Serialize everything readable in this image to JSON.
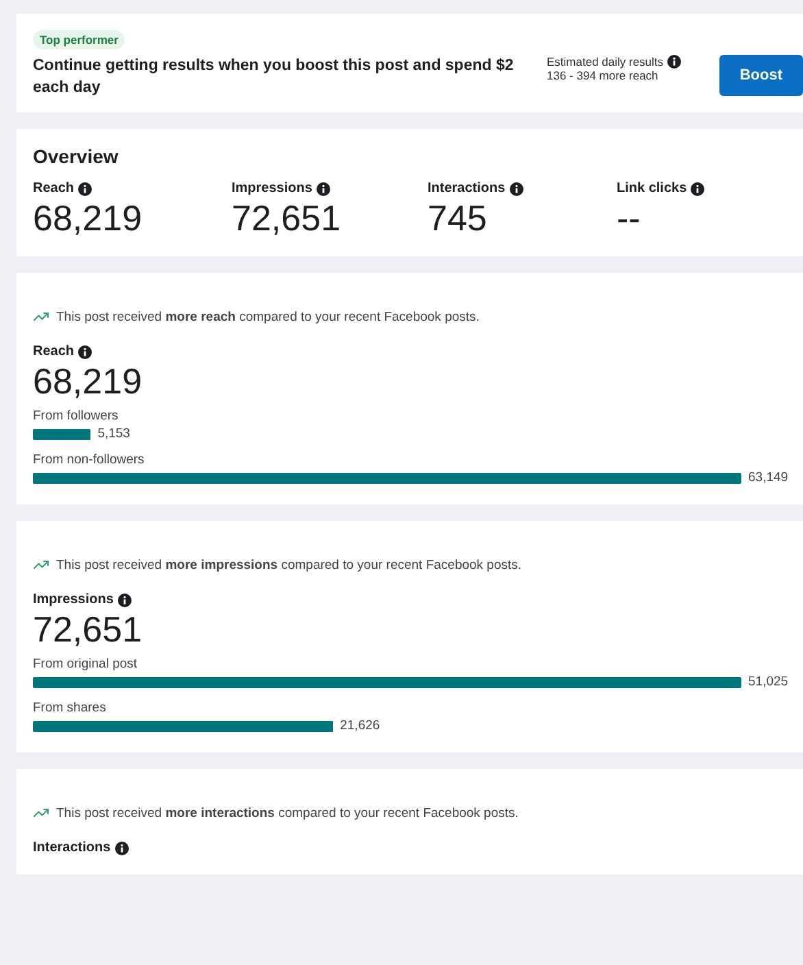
{
  "boost_card": {
    "badge": "Top performer",
    "message": "Continue getting results when you boost this post and spend $2 each day",
    "estimate_label": "Estimated daily results",
    "estimate_value": "136 - 394 more reach",
    "button": "Boost"
  },
  "overview": {
    "title": "Overview",
    "metrics": [
      {
        "label": "Reach",
        "value": "68,219"
      },
      {
        "label": "Impressions",
        "value": "72,651"
      },
      {
        "label": "Interactions",
        "value": "745"
      },
      {
        "label": "Link clicks",
        "value": "--"
      }
    ]
  },
  "sections": [
    {
      "insight": "This post received **more reach** compared to your recent Facebook posts.",
      "label": "Reach",
      "value": "68,219",
      "chart_data": {
        "type": "bar",
        "orientation": "horizontal",
        "categories": [
          "From followers",
          "From non-followers"
        ],
        "values": [
          5153,
          63149
        ],
        "value_labels": [
          "5,153",
          "63,149"
        ]
      }
    },
    {
      "insight": "This post received **more impressions** compared to your recent Facebook posts.",
      "label": "Impressions",
      "value": "72,651",
      "chart_data": {
        "type": "bar",
        "orientation": "horizontal",
        "categories": [
          "From original post",
          "From shares"
        ],
        "values": [
          51025,
          21626
        ],
        "value_labels": [
          "51,025",
          "21,626"
        ]
      }
    },
    {
      "insight": "This post received **more interactions** compared to your recent Facebook posts.",
      "label": "Interactions"
    }
  ]
}
